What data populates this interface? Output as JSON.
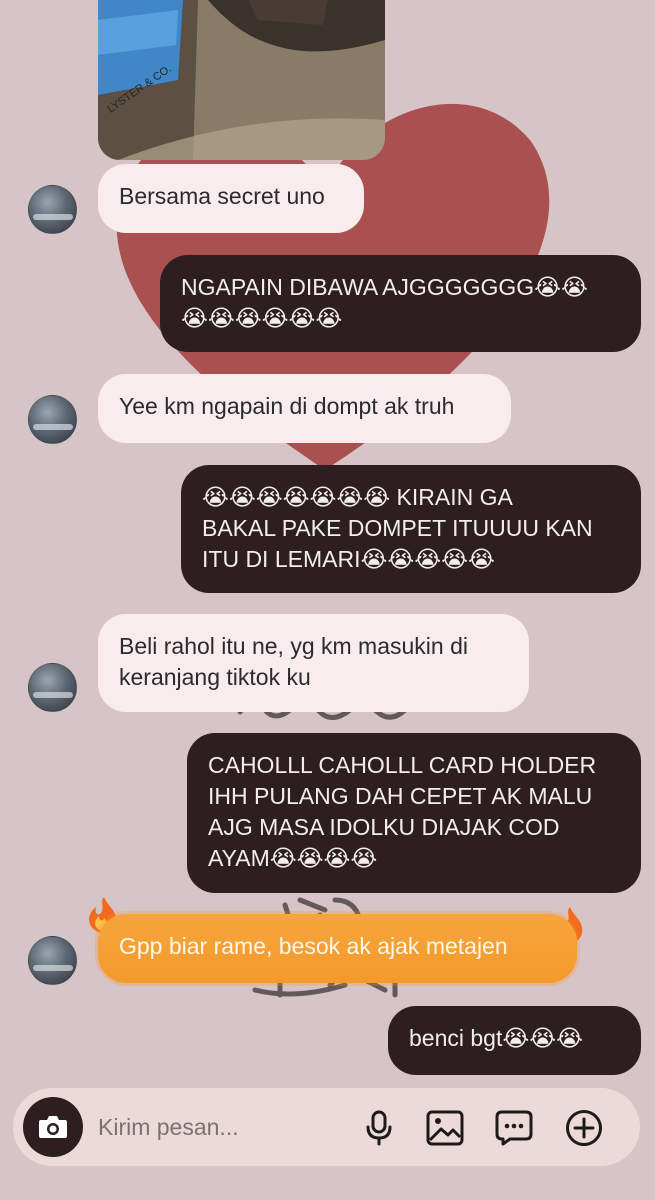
{
  "messages": [
    {
      "from": "them",
      "text": "Bersama secret uno"
    },
    {
      "from": "me",
      "text": "NGAPAIN DIBAWA AJGGGGGGG😭😭\n😭😭😭😭😭😭"
    },
    {
      "from": "them",
      "text": "Yee km ngapain di dompt ak truh"
    },
    {
      "from": "me",
      "text": "😭😭😭😭😭😭😭 KIRAIN GA\nBAKAL PAKE DOMPET ITUUUU KAN\nITU DI LEMARI😭😭😭😭😭"
    },
    {
      "from": "them",
      "text": "Beli rahol itu ne, yg km masukin di\nkeranjang tiktok ku"
    },
    {
      "from": "me",
      "text": "CAHOLLL CAHOLLL CARD HOLDER\nIHH PULANG DAH CEPET AK MALU\nAJG  MASA IDOLKU DIAJAK COD\nAYAM😭😭😭😭"
    },
    {
      "from": "them",
      "text": "Gpp biar rame, besok ak ajak metajen",
      "effect": "fire"
    },
    {
      "from": "me",
      "text": "benci bgt😭😭😭"
    }
  ],
  "composer": {
    "placeholder": "Kirim pesan...",
    "icons": [
      "camera-icon",
      "microphone-icon",
      "image-icon",
      "sticker-icon",
      "plus-icon"
    ]
  },
  "colors": {
    "background": "#d7c4c6",
    "incoming_bubble": "#f8ecee",
    "outgoing_bubble": "#2d1e1f",
    "fire_bubble": "#f39a2c",
    "heart": "#a84a4a"
  }
}
